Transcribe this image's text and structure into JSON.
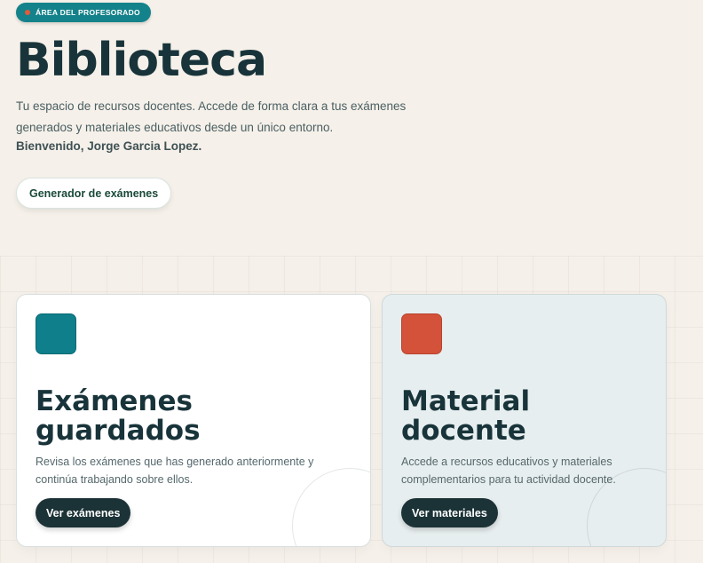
{
  "header": {
    "badge": "ÁREA DEL PROFESORADO",
    "title": "Biblioteca",
    "description": "Tu espacio de recursos docentes. Accede de forma clara a tus exámenes generados y materiales educativos desde un único entorno.",
    "welcome": "Bienvenido, Jorge Garcia Lopez.",
    "generator_button": "Generador de exámenes"
  },
  "cards": [
    {
      "title_line1": "Exámenes",
      "title_line2": "guardados",
      "description": "Revisa los exámenes que has generado anteriormente y continúa trabajando sobre ellos.",
      "button": "Ver exámenes",
      "icon_color": "#0e7f8b"
    },
    {
      "title_line1": "Material",
      "title_line2": "docente",
      "description": "Accede a recursos educativos y materiales complementarios para tu actividad docente.",
      "button": "Ver materiales",
      "icon_color": "#d4513a"
    }
  ],
  "colors": {
    "background": "#f5f0e9",
    "accent_teal": "#14828a",
    "accent_red": "#e25a3b",
    "dark": "#1b3236"
  }
}
